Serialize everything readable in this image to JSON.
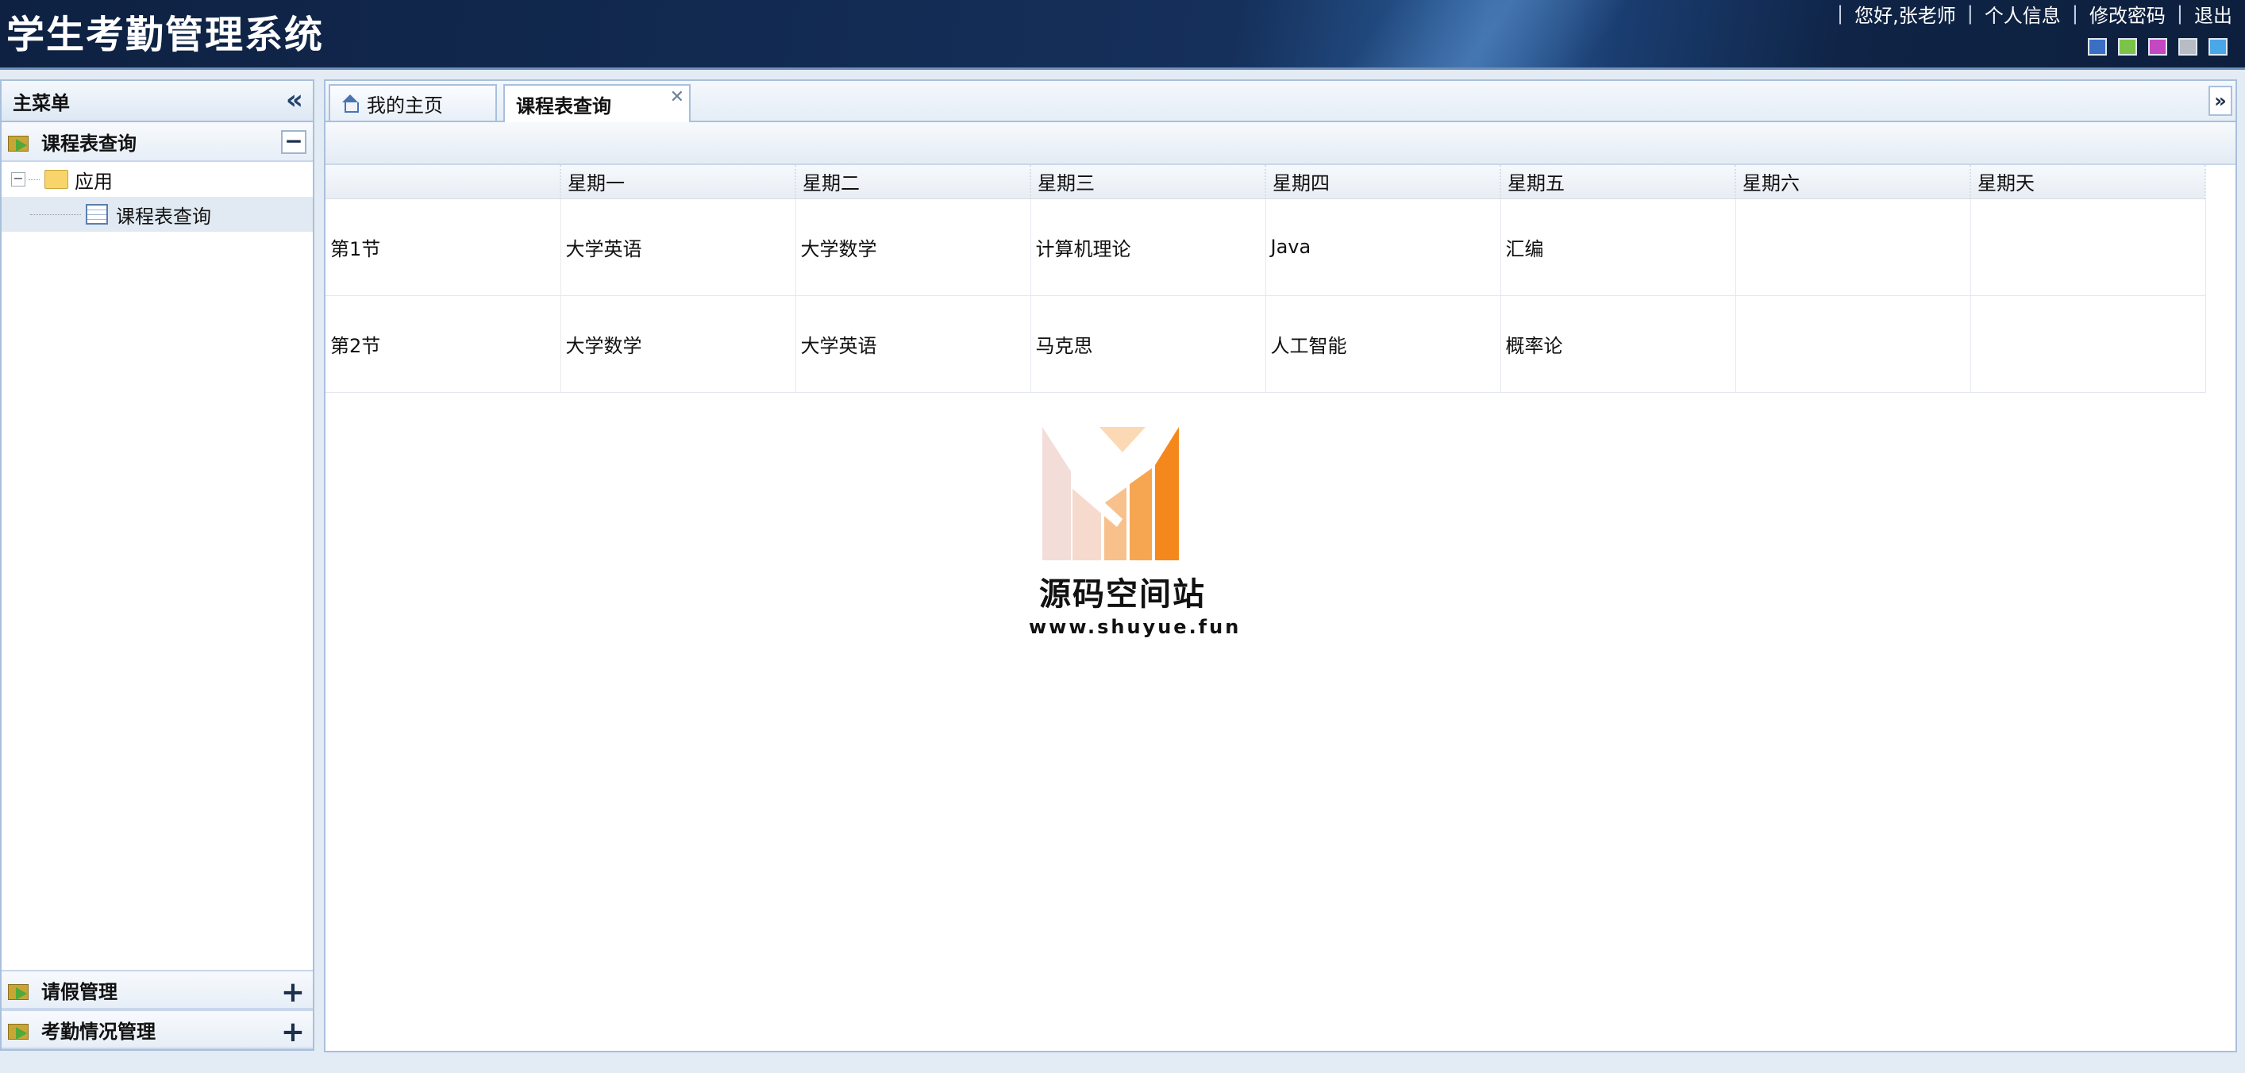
{
  "header": {
    "title": "学生考勤管理系统",
    "greeting": "您好,张老师",
    "profile_link": "个人信息",
    "password_link": "修改密码",
    "logout_link": "退出",
    "separator": "|",
    "theme_colors": [
      "#3a6fc4",
      "#7cc34a",
      "#c548c3",
      "#b8bcc4",
      "#4aa8e8"
    ]
  },
  "sidebar": {
    "title": "主菜单",
    "panels": [
      {
        "label": "课程表查询",
        "expanded": true,
        "tool": "−"
      },
      {
        "label": "请假管理",
        "expanded": false,
        "tool": "+"
      },
      {
        "label": "考勤情况管理",
        "expanded": false,
        "tool": "+"
      }
    ],
    "tree": {
      "folder": "应用",
      "item": "课程表查询"
    }
  },
  "tabs": [
    {
      "label": "我的主页",
      "icon": "home-icon",
      "active": false
    },
    {
      "label": "课程表查询",
      "active": true,
      "closable": true
    }
  ],
  "schedule": {
    "headers": [
      "",
      "星期一",
      "星期二",
      "星期三",
      "星期四",
      "星期五",
      "星期六",
      "星期天"
    ],
    "rows": [
      [
        "第1节",
        "大学英语",
        "大学数学",
        "计算机理论",
        "Java",
        "汇编",
        "",
        ""
      ],
      [
        "第2节",
        "大学数学",
        "大学英语",
        "马克思",
        "人工智能",
        "概率论",
        "",
        ""
      ]
    ]
  },
  "watermark": {
    "title": "源码空间站",
    "url": "www.shuyue.fun"
  }
}
